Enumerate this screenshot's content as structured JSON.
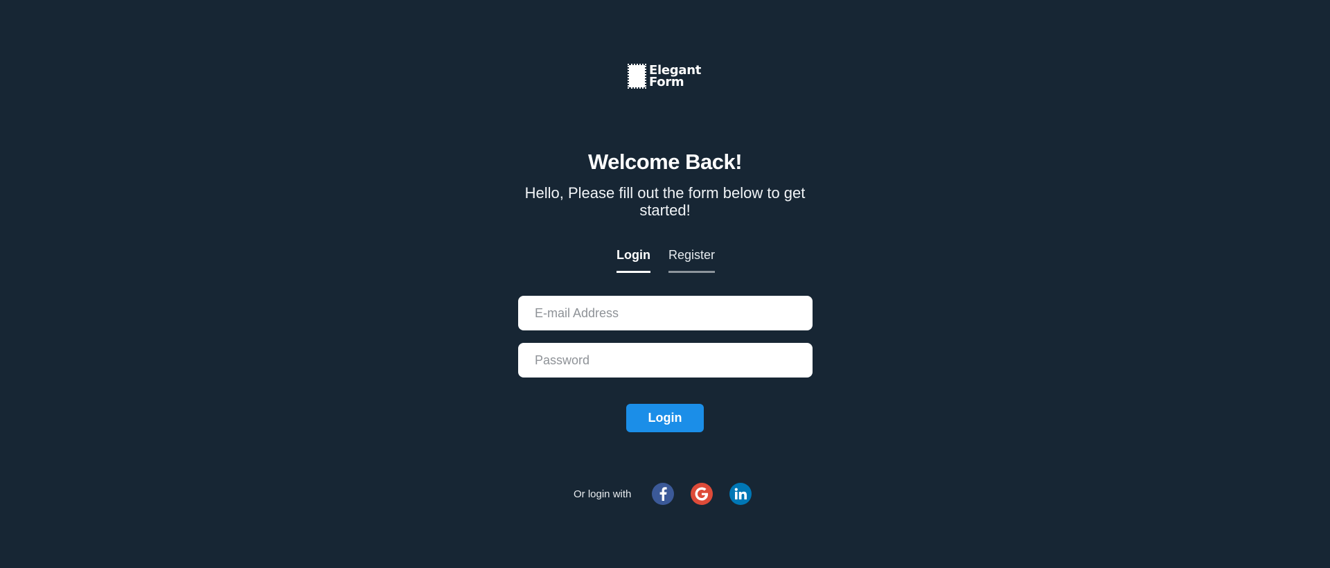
{
  "logo": {
    "line1": "Elegant",
    "line2": "Form"
  },
  "heading": "Welcome Back!",
  "subheading": "Hello, Please fill out the form below to get started!",
  "tabs": [
    {
      "label": "Login",
      "active": true
    },
    {
      "label": "Register",
      "active": false
    }
  ],
  "form": {
    "email_placeholder": "E-mail Address",
    "email_value": "",
    "password_placeholder": "Password",
    "password_value": "",
    "submit_label": "Login"
  },
  "social": {
    "label": "Or login with",
    "providers": [
      {
        "name": "facebook",
        "icon": "facebook-icon",
        "color": "#3b5998"
      },
      {
        "name": "google",
        "icon": "google-icon",
        "color": "#dd4b39"
      },
      {
        "name": "linkedin",
        "icon": "linkedin-icon",
        "color": "#0077b5"
      }
    ]
  },
  "colors": {
    "background": "#172634",
    "accent": "#1b8ee8"
  }
}
